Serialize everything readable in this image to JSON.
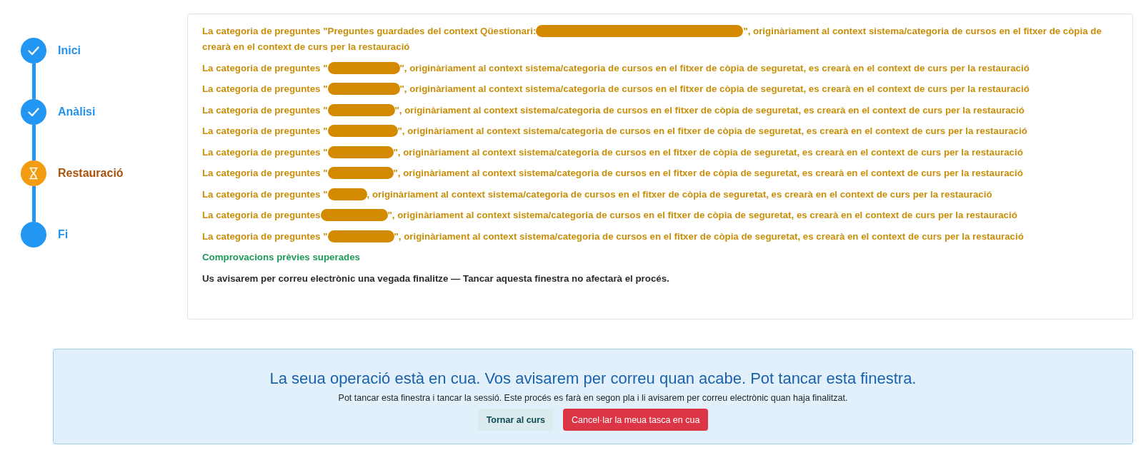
{
  "stepper": {
    "steps": [
      {
        "label": "Inici",
        "completed": true,
        "current": false
      },
      {
        "label": "Anàlisi",
        "completed": true,
        "current": false
      },
      {
        "label": "Restauració",
        "completed": false,
        "current": true
      },
      {
        "label": "Fi",
        "completed": false,
        "current": false
      }
    ]
  },
  "log": {
    "entries": [
      {
        "kind": "warning",
        "before": "La categoria de preguntes \"Preguntes guardades del context Qüestionari:",
        "after": "\", originàriament al context sistema/categoria de cursos en el fitxer de còpia de",
        "continuation": "crearà en el context de curs per la restauració"
      },
      {
        "kind": "warning",
        "before": "La categoria de preguntes \"",
        "after": "\", originàriament al context sistema/categoria de cursos en el fitxer de còpia de seguretat, es crearà en el context de curs per la restauració"
      },
      {
        "kind": "warning",
        "before": "La categoria de preguntes \"",
        "after": "\", originàriament al context sistema/categoria de cursos en el fitxer de còpia de seguretat, es crearà en el context de curs per la restauració"
      },
      {
        "kind": "warning",
        "before": "La categoria de preguntes \"",
        "after": "\", originàriament al context sistema/categoria de cursos en el fitxer de còpia de seguretat, es crearà en el context de curs per la restauració"
      },
      {
        "kind": "warning",
        "before": "La categoria de preguntes \"",
        "after": "\", originàriament al context sistema/categoria de cursos en el fitxer de còpia de seguretat, es crearà en el context de curs per la restauració"
      },
      {
        "kind": "warning",
        "before": "La categoria de preguntes \"",
        "after": "\", originàriament al context sistema/categoria de cursos en el fitxer de còpia de seguretat, es crearà en el context de curs per la restauració"
      },
      {
        "kind": "warning",
        "before": "La categoria de preguntes \"",
        "after": "\", originàriament al context sistema/categoria de cursos en el fitxer de còpia de seguretat, es crearà en el context de curs per la restauració"
      },
      {
        "kind": "warning",
        "before": "La categoria de preguntes \"",
        "after": ", originàriament al context sistema/categoria de cursos en el fitxer de còpia de seguretat, es crearà en el context de curs per la restauració"
      },
      {
        "kind": "warning",
        "before": "La categoria de preguntes",
        "after": "\", originàriament al context sistema/categoria de cursos en el fitxer de còpia de seguretat, es crearà en el context de curs per la restauració"
      },
      {
        "kind": "warning",
        "before": "La categoria de preguntes \"",
        "after": "\", originàriament al context sistema/categoria de cursos en el fitxer de còpia de seguretat, es crearà en el context de curs per la restauració"
      },
      {
        "kind": "success",
        "text": "Comprovacions prèvies superades"
      },
      {
        "kind": "info",
        "text": "Us avisarem per correu electrònic una vegada finalitze — Tancar aquesta finestra no afectarà el procés."
      }
    ]
  },
  "notice": {
    "title": "La seua operació està en cua. Vos avisarem per correu quan acabe. Pot tancar esta finestra.",
    "message": "Pot tancar esta finestra i tancar la sessió. Este procés es farà en segon pla i li avisarem per correu electrònic quan haja finalitzat.",
    "buttons": [
      {
        "label": "Tornar al curs",
        "kind": "secondary"
      },
      {
        "label": "Cancel·lar la meua tasca en cua",
        "kind": "danger"
      }
    ]
  }
}
